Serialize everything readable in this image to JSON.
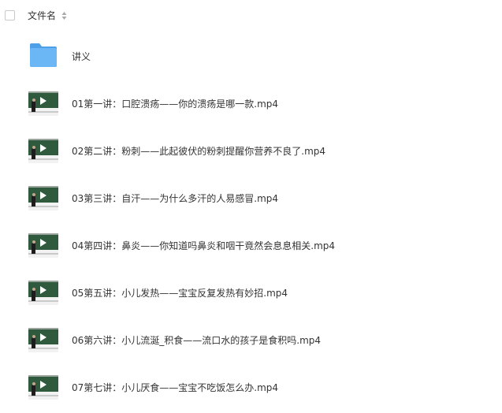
{
  "header": {
    "column_title": "文件名",
    "sort_icon": "sort-updown-icon"
  },
  "rows": [
    {
      "type": "folder",
      "icon": "folder-icon",
      "name": "讲义"
    },
    {
      "type": "video",
      "icon": "video-thumbnail-icon",
      "name": "01第一讲：口腔溃疡——你的溃疡是哪一款.mp4"
    },
    {
      "type": "video",
      "icon": "video-thumbnail-icon",
      "name": "02第二讲：粉刺——此起彼伏的粉刺提醒你营养不良了.mp4"
    },
    {
      "type": "video",
      "icon": "video-thumbnail-icon",
      "name": "03第三讲：自汗——为什么多汗的人易感冒.mp4"
    },
    {
      "type": "video",
      "icon": "video-thumbnail-icon",
      "name": "04第四讲：鼻炎——你知道吗鼻炎和咽干竟然会息息相关.mp4"
    },
    {
      "type": "video",
      "icon": "video-thumbnail-icon",
      "name": "05第五讲：小儿发热——宝宝反复发热有妙招.mp4"
    },
    {
      "type": "video",
      "icon": "video-thumbnail-icon",
      "name": "06第六讲：小儿流涎_积食——流口水的孩子是食积吗.mp4"
    },
    {
      "type": "video",
      "icon": "video-thumbnail-icon",
      "name": "07第七讲：小儿厌食——宝宝不吃饭怎么办.mp4"
    }
  ],
  "colors": {
    "folder_blue": "#5aa9f0",
    "text": "#333333",
    "board_green": "#2f5a3e"
  }
}
